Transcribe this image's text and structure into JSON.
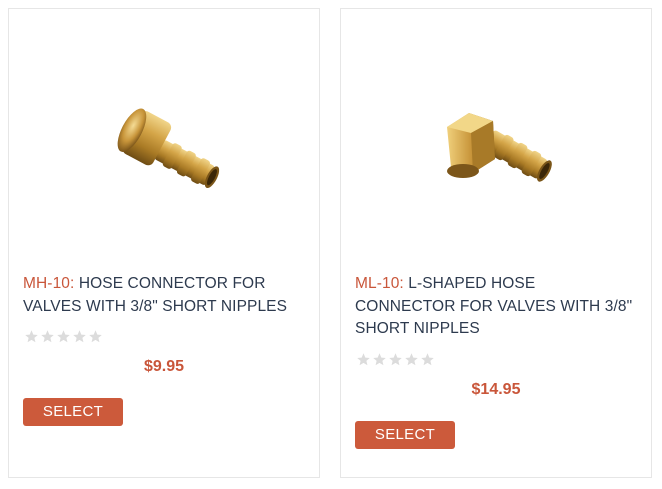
{
  "products": [
    {
      "sku": "MH-10:",
      "name": " HOSE CONNECTOR FOR VALVES WITH 3/8\" SHORT NIPPLES",
      "price": "$9.95",
      "rating": 0,
      "button_label": "SELECT",
      "image_icon": "brass-hose-connector-image"
    },
    {
      "sku": "ML-10:",
      "name": " L-SHAPED HOSE CONNECTOR FOR VALVES WITH 3/8\" SHORT NIPPLES",
      "price": "$14.95",
      "rating": 0,
      "button_label": "SELECT",
      "image_icon": "brass-l-shaped-hose-connector-image"
    }
  ],
  "colors": {
    "accent": "#cc5a3b",
    "sku": "#c9563a",
    "title": "#2d3a4e",
    "star_empty": "#dcdcdc",
    "border": "#e6e6e6"
  }
}
